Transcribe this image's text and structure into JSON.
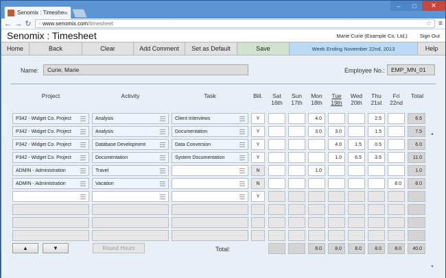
{
  "browser": {
    "tab_title": "Senomix : Timesheet",
    "url_host": "www.senomix.com",
    "url_path": "/timesheet"
  },
  "app": {
    "title": "Senomix : Timesheet",
    "user": "Marie Curie  (Example Co. Ltd.)",
    "sign_out": "Sign Out"
  },
  "menu": {
    "home": "Home",
    "back": "Back",
    "clear": "Clear",
    "add_comment": "Add Comment",
    "set_default": "Set as Default",
    "save": "Save",
    "week": "Week Ending November 22nd, 2013",
    "help": "Help"
  },
  "employee": {
    "name_label": "Name:",
    "name": "Curie, Marie",
    "no_label": "Employee No.:",
    "no": "EMP_MN_01"
  },
  "columns": {
    "project": "Project",
    "activity": "Activity",
    "task": "Task",
    "bill": "Bill.",
    "days": [
      {
        "d": "Sat",
        "n": "16th"
      },
      {
        "d": "Sun",
        "n": "17th"
      },
      {
        "d": "Mon",
        "n": "18th"
      },
      {
        "d": "Tue",
        "n": "19th"
      },
      {
        "d": "Wed",
        "n": "20th"
      },
      {
        "d": "Thu",
        "n": "21st"
      },
      {
        "d": "Fri",
        "n": "22nd"
      }
    ],
    "total": "Total"
  },
  "rows": [
    {
      "project": "P342 - Widget Co. Project",
      "activity": "Analysis",
      "task": "Client Interviews",
      "bill": "Y",
      "hours": [
        "",
        "",
        "4.0",
        "",
        "",
        "2.5",
        ""
      ],
      "total": "6.5"
    },
    {
      "project": "P342 - Widget Co. Project",
      "activity": "Analysis",
      "task": "Documentation",
      "bill": "Y",
      "hours": [
        "",
        "",
        "3.0",
        "3.0",
        "",
        "1.5",
        ""
      ],
      "total": "7.5"
    },
    {
      "project": "P342 - Widget Co. Project",
      "activity": "Database Development",
      "task": "Data Conversion",
      "bill": "Y",
      "hours": [
        "",
        "",
        "",
        "4.0",
        "1.5",
        "0.5",
        ""
      ],
      "total": "6.0"
    },
    {
      "project": "P342 - Widget Co. Project",
      "activity": "Documentation",
      "task": "System Documentation",
      "bill": "Y",
      "hours": [
        "",
        "",
        "",
        "1.0",
        "6.5",
        "3.5",
        ""
      ],
      "total": "11.0"
    },
    {
      "project": "ADMIN - Administration",
      "activity": "Travel",
      "task": "",
      "bill": "N",
      "hours": [
        "",
        "",
        "1.0",
        "",
        "",
        "",
        ""
      ],
      "total": "1.0"
    },
    {
      "project": "ADMIN - Administration",
      "activity": "Vacation",
      "task": "",
      "bill": "N",
      "hours": [
        "",
        "",
        "",
        "",
        "",
        "",
        "8.0"
      ],
      "total": "8.0"
    },
    {
      "project": "",
      "activity": "",
      "task": "",
      "bill": "Y",
      "hours": [
        "",
        "",
        "",
        "",
        "",
        "",
        ""
      ],
      "total": ""
    },
    {
      "project": "",
      "activity": "",
      "task": "",
      "bill": "",
      "hours": [
        "",
        "",
        "",
        "",
        "",
        "",
        ""
      ],
      "total": ""
    },
    {
      "project": "",
      "activity": "",
      "task": "",
      "bill": "",
      "hours": [
        "",
        "",
        "",
        "",
        "",
        "",
        ""
      ],
      "total": ""
    },
    {
      "project": "",
      "activity": "",
      "task": "",
      "bill": "",
      "hours": [
        "",
        "",
        "",
        "",
        "",
        "",
        ""
      ],
      "total": ""
    }
  ],
  "footer": {
    "up": "▲",
    "down": "▼",
    "round": "Round Hours",
    "total_label": "Total:",
    "day_totals": [
      "",
      "",
      "8.0",
      "8.0",
      "8.0",
      "8.0",
      "8.0"
    ],
    "grand_total": "40.0"
  }
}
